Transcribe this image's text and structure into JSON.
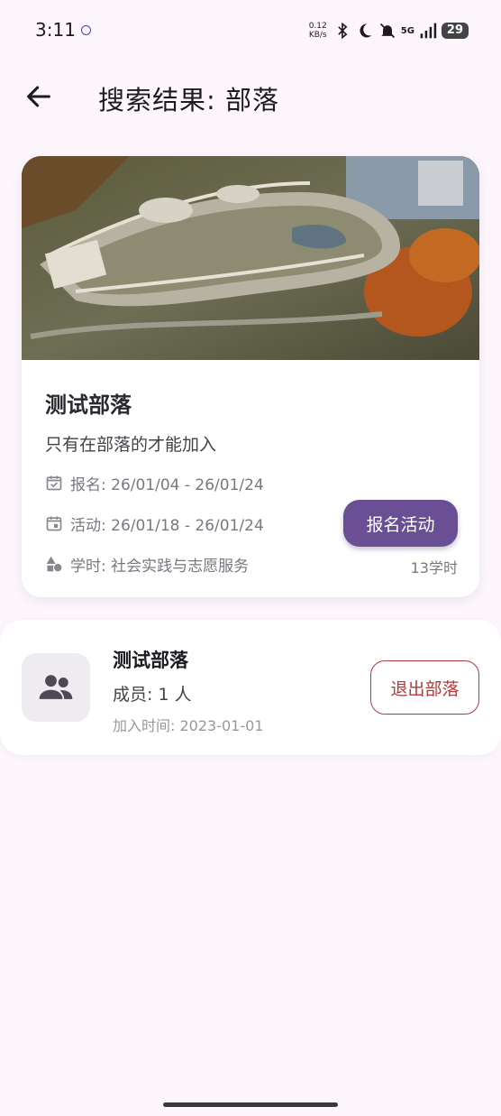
{
  "status_bar": {
    "time": "3:11",
    "net_speed_value": "0.12",
    "net_speed_unit": "KB/s",
    "network": "5G",
    "battery": "29",
    "icons": [
      "bluetooth-icon",
      "moon-icon",
      "silent-icon",
      "signal-icon"
    ]
  },
  "app_bar": {
    "back_icon": "arrow-left-icon",
    "title": "搜索结果: 部落"
  },
  "activity": {
    "image_alt": "建筑航拍图",
    "title": "测试部落",
    "description": "只有在部落的才能加入",
    "signup_range": "报名: 26/01/04 - 26/01/24",
    "activity_range": "活动: 26/01/18 - 26/01/24",
    "category": "学时: 社会实践与志愿服务",
    "hours": "13学时",
    "button_label": "报名活动",
    "accent": "#6b4f94"
  },
  "tribe": {
    "icon": "group-icon",
    "name": "测试部落",
    "members": "成员: 1 人",
    "joined": "加入时间: 2023-01-01",
    "exit_label": "退出部落",
    "exit_color": "#b03a3a"
  }
}
